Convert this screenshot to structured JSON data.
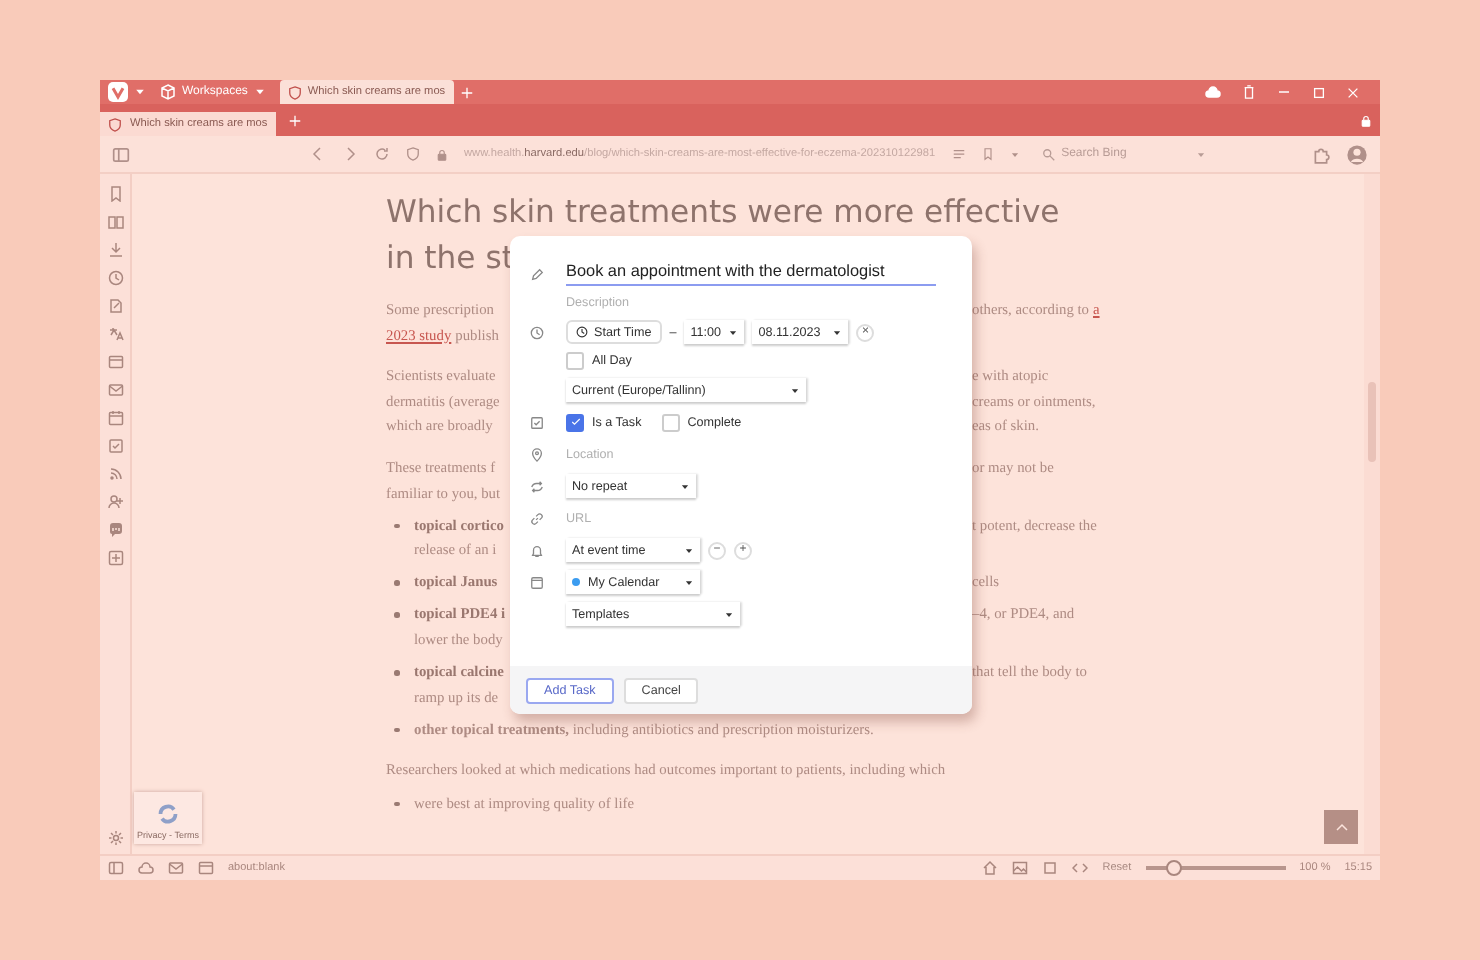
{
  "browser": {
    "workspaces": "Workspaces",
    "tabs": [
      {
        "title": "Which skin creams are mos",
        "selected": true
      }
    ],
    "stack_tabs": [
      {
        "title": "Which skin creams are mos",
        "selected": true
      }
    ],
    "address": {
      "host_prefix": "www.health.",
      "host": "harvard.edu",
      "path": "/blog/which-skin-creams-are-most-effective-for-eczema-202310122981"
    },
    "search": {
      "placeholder": "Search Bing"
    }
  },
  "article": {
    "heading": [
      {
        "left": "Which skin treatments were more effective"
      },
      {
        "left": "in the st"
      }
    ],
    "blocks": [
      {
        "kind": "para",
        "lines": [
          {
            "left": [
              {
                "kind": "text",
                "text": "Some prescription"
              }
            ],
            "right": [
              {
                "kind": "text",
                "text": "others, according to"
              },
              {
                "kind": "link",
                "text": "a"
              }
            ]
          },
          {
            "left": [
              {
                "kind": "link",
                "text": "2023 study"
              },
              {
                "kind": "text",
                "text": "publish"
              }
            ]
          }
        ]
      },
      {
        "kind": "para",
        "lines": [
          {
            "left": [
              {
                "kind": "text",
                "text": "Scientists evaluate"
              }
            ],
            "right": [
              {
                "kind": "text",
                "text": "e with atopic"
              }
            ]
          },
          {
            "left": [
              {
                "kind": "text",
                "text": "dermatitis (average"
              }
            ],
            "right": [
              {
                "kind": "text",
                "text": "creams or ointments,"
              }
            ]
          },
          {
            "left": [
              {
                "kind": "text",
                "text": "which are broadly"
              }
            ],
            "right": [
              {
                "kind": "text",
                "text": "eas of skin."
              }
            ]
          }
        ]
      },
      {
        "kind": "para",
        "lines": [
          {
            "left": [
              {
                "kind": "text",
                "text": "These treatments f"
              }
            ],
            "right": [
              {
                "kind": "text",
                "text": "or may not be"
              }
            ]
          },
          {
            "left": [
              {
                "kind": "text",
                "text": "familiar to you, but"
              }
            ]
          }
        ]
      },
      {
        "kind": "bullet",
        "lines": [
          {
            "left": [
              {
                "kind": "bold",
                "text": "topical cortico"
              }
            ],
            "right": [
              {
                "kind": "text",
                "text": "t potent, decrease the"
              }
            ]
          },
          {
            "left": [
              {
                "kind": "text",
                "text": "release of an i"
              }
            ]
          }
        ]
      },
      {
        "kind": "bullet",
        "lines": [
          {
            "left": [
              {
                "kind": "bold",
                "text": "topical Janus"
              }
            ],
            "right": [
              {
                "kind": "text",
                "text": "cells"
              }
            ]
          }
        ]
      },
      {
        "kind": "bullet",
        "lines": [
          {
            "left": [
              {
                "kind": "bold",
                "text": "topical PDE4 i"
              }
            ],
            "right": [
              {
                "kind": "text",
                "text": "–4, or PDE4, and"
              }
            ]
          },
          {
            "left": [
              {
                "kind": "text",
                "text": "lower the body"
              }
            ]
          }
        ]
      },
      {
        "kind": "bullet",
        "lines": [
          {
            "left": [
              {
                "kind": "bold",
                "text": "topical calcine"
              }
            ],
            "right": [
              {
                "kind": "text",
                "text": "that tell the body to"
              }
            ]
          },
          {
            "left": [
              {
                "kind": "text",
                "text": "ramp up its de"
              }
            ]
          }
        ]
      },
      {
        "kind": "bullet",
        "lines": [
          {
            "full": "**other topical treatments,** including antibiotics and prescription moisturizers."
          }
        ]
      },
      {
        "kind": "para",
        "lines": [
          {
            "full": "Researchers looked at which medications had outcomes important to patients, including which"
          }
        ]
      },
      {
        "kind": "bullet",
        "lines": [
          {
            "full": "were best at improving quality of life"
          }
        ]
      }
    ]
  },
  "recaptcha": {
    "links": "Privacy - Terms"
  },
  "dialog": {
    "title_value": "Book an appointment with the dermatologist",
    "description_placeholder": "Description",
    "start_button": "Start Time",
    "dash": "–",
    "time": "11:00",
    "date": "08.11.2023",
    "clear": "×",
    "all_day": {
      "label": "All Day",
      "checked": false
    },
    "timezone": "Current (Europe/Tallinn)",
    "is_task": {
      "label": "Is a Task",
      "checked": true
    },
    "complete": {
      "label": "Complete",
      "checked": false
    },
    "location_placeholder": "Location",
    "repeat": "No repeat",
    "url_placeholder": "URL",
    "reminder": "At event time",
    "minus": "−",
    "plus": "+",
    "calendar": {
      "label": "My Calendar",
      "color": "#3b9cf0"
    },
    "template": "Templates",
    "buttons": [
      {
        "label": "Add Task",
        "kind": "primary"
      },
      {
        "label": "Cancel",
        "kind": "secondary"
      }
    ]
  },
  "status_bar": {
    "url": "about:blank",
    "reset": "Reset",
    "zoom": {
      "level": 0.2
    },
    "zoom_reading": "100 %",
    "clock": "15:15"
  }
}
